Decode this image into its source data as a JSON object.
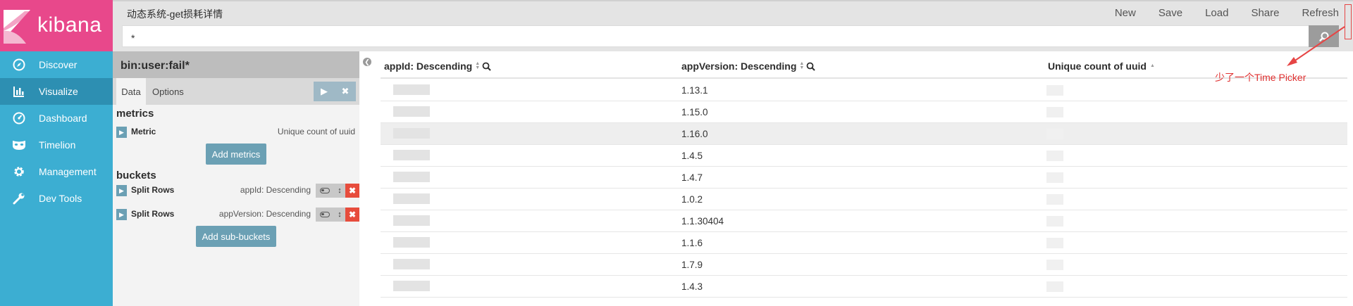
{
  "app": {
    "logo_text": "kibana"
  },
  "nav": {
    "items": [
      {
        "label": "Discover",
        "icon": "compass-icon"
      },
      {
        "label": "Visualize",
        "icon": "bar-chart-icon"
      },
      {
        "label": "Dashboard",
        "icon": "gauge-icon"
      },
      {
        "label": "Timelion",
        "icon": "mask-icon"
      },
      {
        "label": "Management",
        "icon": "gear-icon"
      },
      {
        "label": "Dev Tools",
        "icon": "wrench-icon"
      }
    ],
    "active": "Visualize"
  },
  "header": {
    "title": "动态系统-get损耗详情",
    "menu": [
      "New",
      "Save",
      "Load",
      "Share",
      "Refresh"
    ],
    "query": "*",
    "search_icon": "search-icon"
  },
  "editor": {
    "title": "bin:user:fail*",
    "tabs": [
      "Data",
      "Options"
    ],
    "active_tab": "Data",
    "metrics_label": "metrics",
    "buckets_label": "buckets",
    "metric": {
      "label": "Metric",
      "desc": "Unique count of uuid"
    },
    "add_metrics": "Add metrics",
    "buckets": [
      {
        "label": "Split Rows",
        "desc": "appId: Descending"
      },
      {
        "label": "Split Rows",
        "desc": "appVersion: Descending"
      }
    ],
    "add_sub_buckets": "Add sub-buckets"
  },
  "table": {
    "columns": [
      "appId: Descending",
      "appVersion: Descending",
      "Unique count of uuid"
    ],
    "rows": [
      {
        "appVersion": "1.13.1"
      },
      {
        "appVersion": "1.15.0"
      },
      {
        "appVersion": "1.16.0"
      },
      {
        "appVersion": "1.4.5"
      },
      {
        "appVersion": "1.4.7"
      },
      {
        "appVersion": "1.0.2"
      },
      {
        "appVersion": "1.1.30404"
      },
      {
        "appVersion": "1.1.6"
      },
      {
        "appVersion": "1.7.9"
      },
      {
        "appVersion": "1.4.3"
      }
    ],
    "hover_row_index": 2
  },
  "annotation": {
    "text": "少了一个Time Picker",
    "color": "#e03030"
  },
  "colors": {
    "logo_bg": "#e8488b",
    "sidebar_bg": "#3caed2",
    "sidebar_active": "#2d8fb2",
    "button": "#6ba0b4",
    "danger": "#e74c3c"
  }
}
